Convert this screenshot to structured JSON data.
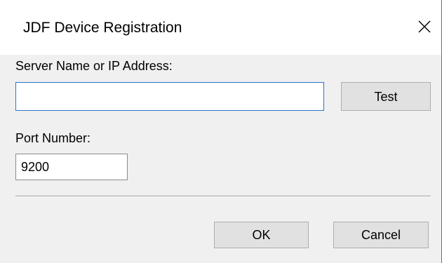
{
  "dialog": {
    "title": "JDF Device Registration",
    "close_icon": "close-icon",
    "accent_color": "#2f73c7"
  },
  "form": {
    "server_label": "Server Name or IP Address:",
    "server_value": "",
    "port_label": "Port Number:",
    "port_value": "9200"
  },
  "buttons": {
    "test_label": "Test",
    "ok_label": "OK",
    "cancel_label": "Cancel"
  }
}
